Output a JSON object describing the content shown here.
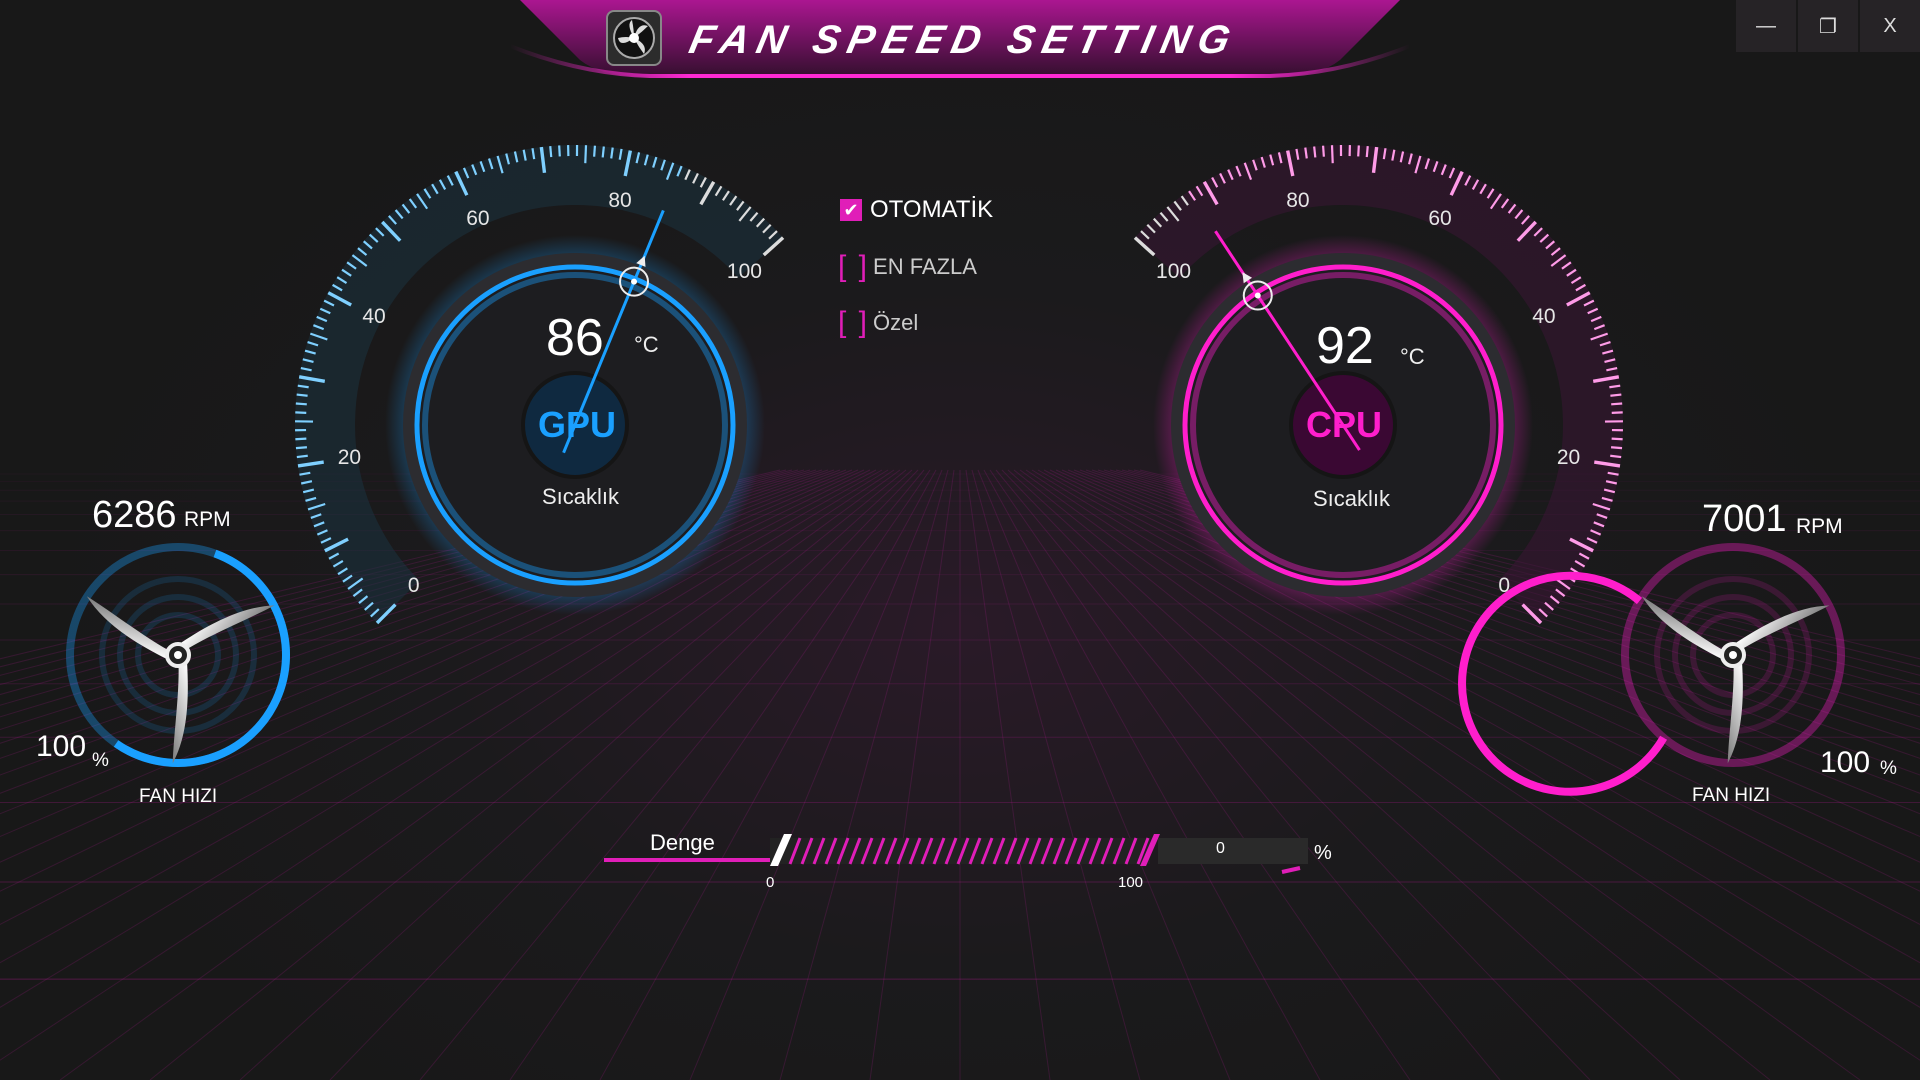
{
  "app": {
    "title": "FAN SPEED SETTING"
  },
  "window_controls": {
    "minimize": "—",
    "restore": "❐",
    "close": "X"
  },
  "colors": {
    "gpu_accent": "#1aa0ff",
    "cpu_accent": "#ff1ecc",
    "brand": "#e01eb8"
  },
  "gpu": {
    "chip": "GPU",
    "temperature": "86",
    "temperature_value": 86,
    "unit": "°C",
    "label": "Sıcaklık",
    "scale": [
      "0",
      "20",
      "40",
      "60",
      "80",
      "100"
    ],
    "fan": {
      "rpm": "6286",
      "rpm_unit": "RPM",
      "percent": "100",
      "percent_unit": "%",
      "label": "FAN HIZI",
      "icon": "fan-icon"
    }
  },
  "cpu": {
    "chip": "CPU",
    "temperature": "92",
    "temperature_value": 92,
    "unit": "°C",
    "label": "Sıcaklık",
    "scale": [
      "0",
      "20",
      "40",
      "60",
      "80",
      "100"
    ],
    "fan": {
      "rpm": "7001",
      "rpm_unit": "RPM",
      "percent": "100",
      "percent_unit": "%",
      "label": "FAN HIZI",
      "icon": "fan-icon"
    }
  },
  "modes": [
    {
      "label": "OTOMATİK",
      "checked": true
    },
    {
      "label": "EN FAZLA",
      "checked": false
    },
    {
      "label": "Özel",
      "checked": false
    }
  ],
  "slider": {
    "label": "Denge",
    "min_label": "0",
    "max_label": "100",
    "value": "0",
    "unit": "%"
  }
}
